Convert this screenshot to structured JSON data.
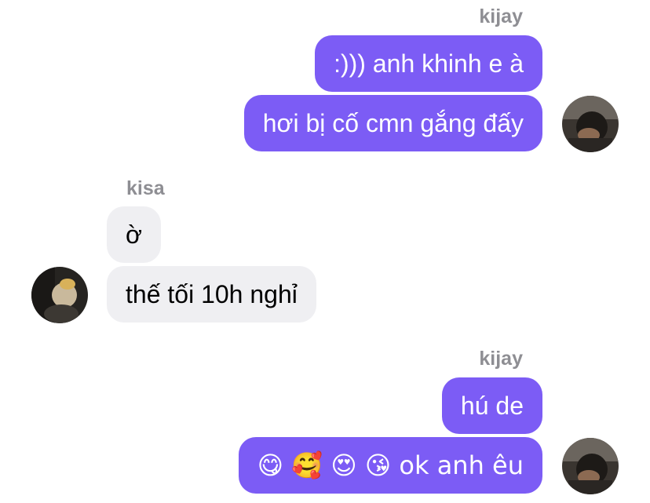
{
  "groups": [
    {
      "sender": "kijay",
      "direction": "out",
      "messages": [
        ":))) anh khinh e à",
        "hơi bị cố cmn gắng đấy"
      ]
    },
    {
      "sender": "kisa",
      "direction": "in",
      "messages": [
        "ờ",
        "thế tối 10h nghỉ"
      ]
    },
    {
      "sender": "kijay",
      "direction": "out",
      "messages": [
        "hú de",
        "😋 🥰 😍 😘 ok anh êu"
      ]
    }
  ],
  "colors": {
    "outgoing_bubble": "#7c5cf5",
    "incoming_bubble": "#efeff2",
    "sender_name": "#8e8e93"
  }
}
